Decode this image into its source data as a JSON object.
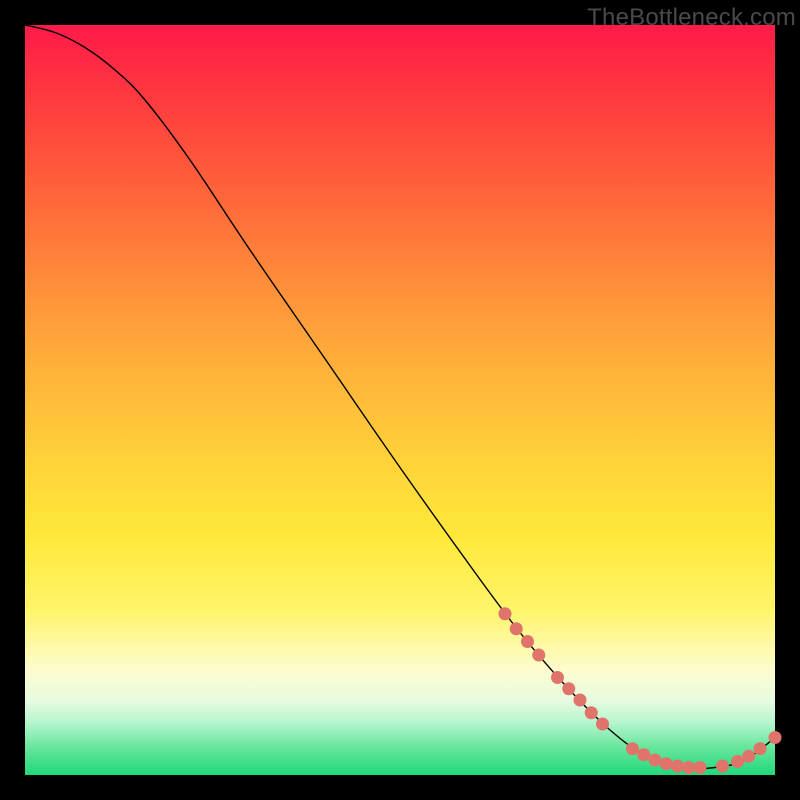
{
  "watermark": "TheBottleneck.com",
  "colors": {
    "curve_stroke": "#000000",
    "marker_fill": "#e0746a",
    "marker_stroke": "#c45a50"
  },
  "chart_data": {
    "type": "line",
    "title": "",
    "xlabel": "",
    "ylabel": "",
    "xlim": [
      0,
      100
    ],
    "ylim": [
      0,
      100
    ],
    "curve": [
      {
        "x": 0,
        "y": 100
      },
      {
        "x": 4,
        "y": 99
      },
      {
        "x": 8,
        "y": 97
      },
      {
        "x": 12,
        "y": 94
      },
      {
        "x": 16,
        "y": 90
      },
      {
        "x": 22,
        "y": 82
      },
      {
        "x": 30,
        "y": 70
      },
      {
        "x": 40,
        "y": 55.5
      },
      {
        "x": 50,
        "y": 41
      },
      {
        "x": 60,
        "y": 27
      },
      {
        "x": 66,
        "y": 19
      },
      {
        "x": 72,
        "y": 12
      },
      {
        "x": 78,
        "y": 6
      },
      {
        "x": 83,
        "y": 2.5
      },
      {
        "x": 88,
        "y": 1
      },
      {
        "x": 92,
        "y": 1
      },
      {
        "x": 96,
        "y": 2
      },
      {
        "x": 100,
        "y": 5
      }
    ],
    "markers": [
      {
        "x": 64,
        "y": 21.5
      },
      {
        "x": 65.5,
        "y": 19.5
      },
      {
        "x": 67,
        "y": 17.8
      },
      {
        "x": 68.5,
        "y": 16
      },
      {
        "x": 71,
        "y": 13
      },
      {
        "x": 72.5,
        "y": 11.5
      },
      {
        "x": 74,
        "y": 10
      },
      {
        "x": 75.5,
        "y": 8.3
      },
      {
        "x": 77,
        "y": 6.8
      },
      {
        "x": 81,
        "y": 3.5
      },
      {
        "x": 82.5,
        "y": 2.7
      },
      {
        "x": 84,
        "y": 2
      },
      {
        "x": 85.5,
        "y": 1.5
      },
      {
        "x": 87,
        "y": 1.2
      },
      {
        "x": 88.5,
        "y": 1
      },
      {
        "x": 90,
        "y": 1
      },
      {
        "x": 93,
        "y": 1.2
      },
      {
        "x": 95,
        "y": 1.8
      },
      {
        "x": 96.5,
        "y": 2.5
      },
      {
        "x": 98,
        "y": 3.5
      },
      {
        "x": 100,
        "y": 5
      }
    ]
  }
}
